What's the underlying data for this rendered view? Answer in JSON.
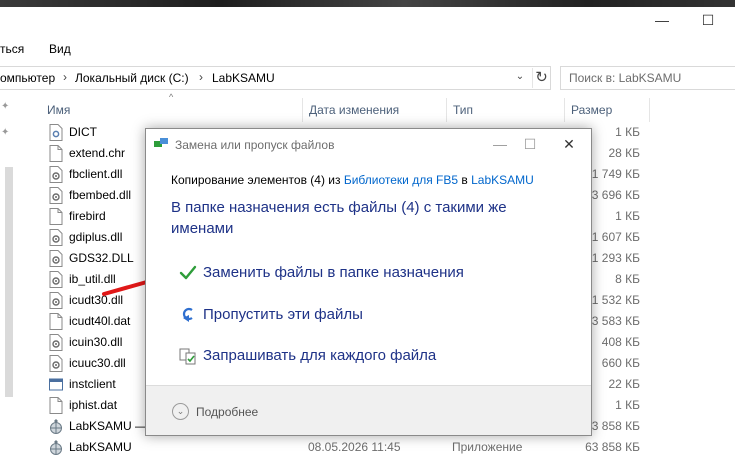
{
  "window": {
    "minimize_glyph": "—",
    "maximize_glyph": "☐"
  },
  "menu": {
    "items": [
      "ться",
      "Вид"
    ]
  },
  "address": {
    "segments": [
      "омпьютер",
      "Локальный диск (C:)",
      "LabKSAMU"
    ],
    "separator": "›",
    "dropdown_glyph": "⌄",
    "refresh_glyph": "↻"
  },
  "search": {
    "placeholder": "Поиск в: LabKSAMU"
  },
  "columns": {
    "name": "Имя",
    "date": "Дата изменения",
    "type": "Тип",
    "size": "Размер",
    "sort_glyph": "^"
  },
  "files": [
    {
      "name": "DICT",
      "date": "",
      "type": "",
      "size": "1 КБ",
      "icon": "settings-file-icon"
    },
    {
      "name": "extend.chr",
      "date": "",
      "type": "",
      "size": "28 КБ",
      "icon": "blank-file-icon"
    },
    {
      "name": "fbclient.dll",
      "date": "",
      "type": "",
      "size": "1 749 КБ",
      "icon": "dll-file-icon"
    },
    {
      "name": "fbembed.dll",
      "date": "",
      "type": "",
      "size": "3 696 КБ",
      "icon": "dll-file-icon"
    },
    {
      "name": "firebird",
      "date": "",
      "type": "",
      "size": "1 КБ",
      "icon": "blank-file-icon"
    },
    {
      "name": "gdiplus.dll",
      "date": "",
      "type": "",
      "size": "1 607 КБ",
      "icon": "dll-file-icon"
    },
    {
      "name": "GDS32.DLL",
      "date": "",
      "type": "",
      "size": "1 293 КБ",
      "icon": "dll-file-icon"
    },
    {
      "name": "ib_util.dll",
      "date": "",
      "type": "",
      "size": "8 КБ",
      "icon": "dll-file-icon"
    },
    {
      "name": "icudt30.dll",
      "date": "",
      "type": "",
      "size": "1 532 КБ",
      "icon": "dll-file-icon"
    },
    {
      "name": "icudt40l.dat",
      "date": "",
      "type": "",
      "size": "13 583 КБ",
      "icon": "blank-file-icon"
    },
    {
      "name": "icuin30.dll",
      "date": "",
      "type": "",
      "size": "408 КБ",
      "icon": "dll-file-icon"
    },
    {
      "name": "icuuc30.dll",
      "date": "",
      "type": "",
      "size": "660 КБ",
      "icon": "dll-file-icon"
    },
    {
      "name": "instclient",
      "date": "",
      "type": "",
      "size": "22 КБ",
      "icon": "app-window-icon"
    },
    {
      "name": "iphist.dat",
      "date": "",
      "type": "",
      "size": "1 КБ",
      "icon": "blank-file-icon"
    },
    {
      "name": "LabKSAMU —",
      "date": "",
      "type": "",
      "size": "63 858 КБ",
      "icon": "app-globe-icon"
    },
    {
      "name": "LabKSAMU",
      "date": "08.05.2026 11:45",
      "type": "Приложение",
      "size": "63 858 КБ",
      "icon": "app-globe-icon"
    }
  ],
  "dialog": {
    "title": "Замена или пропуск файлов",
    "copy_prefix": "Копирование элементов (4) из ",
    "copy_source": "Библиотеки для FB5",
    "copy_middle": " в ",
    "copy_dest": "LabKSAMU",
    "heading": "В папке назначения есть файлы (4) с такими же именами",
    "options": [
      {
        "label": "Заменить файлы в папке назначения",
        "icon": "checkmark-icon"
      },
      {
        "label": "Пропустить эти файлы",
        "icon": "skip-arrow-icon"
      },
      {
        "label": "Запрашивать для каждого файла",
        "icon": "compare-files-icon"
      }
    ],
    "more_label": "Подробнее",
    "minimize_glyph": "—",
    "maximize_glyph": "☐",
    "close_glyph": "✕"
  },
  "colors": {
    "accent_blue": "#1e3287",
    "link_blue": "#0066cc",
    "check_green": "#2e9d3a",
    "annotation_red": "#e01818"
  }
}
